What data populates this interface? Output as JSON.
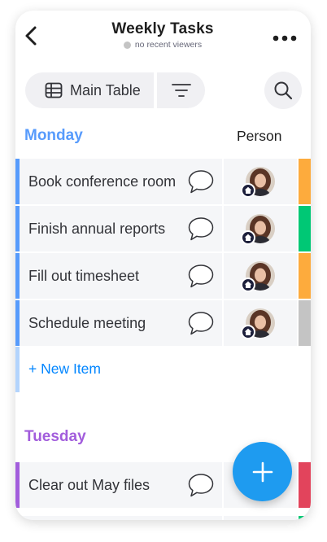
{
  "header": {
    "title": "Weekly Tasks",
    "subtitle": "no recent viewers"
  },
  "toolbar": {
    "view_label": "Main Table"
  },
  "columns": {
    "person": "Person"
  },
  "groups": [
    {
      "title": "Monday",
      "color": "#579bfc",
      "items": [
        {
          "name": "Book conference room",
          "status_color": "#fdab3d"
        },
        {
          "name": "Finish annual reports",
          "status_color": "#00c875"
        },
        {
          "name": "Fill out timesheet",
          "status_color": "#fdab3d"
        },
        {
          "name": "Schedule meeting",
          "status_color": "#c4c4c4"
        }
      ],
      "new_item_label": "+ New Item"
    },
    {
      "title": "Tuesday",
      "color": "#a25ddc",
      "items": [
        {
          "name": "Clear out May files",
          "status_color": "#e2445c"
        }
      ]
    }
  ],
  "icons": {
    "back": "chevron-left-icon",
    "more": "more-horizontal-icon",
    "table": "table-icon",
    "filter": "filter-icon",
    "search": "search-icon",
    "comment": "comment-bubble-icon",
    "add": "plus-icon"
  }
}
